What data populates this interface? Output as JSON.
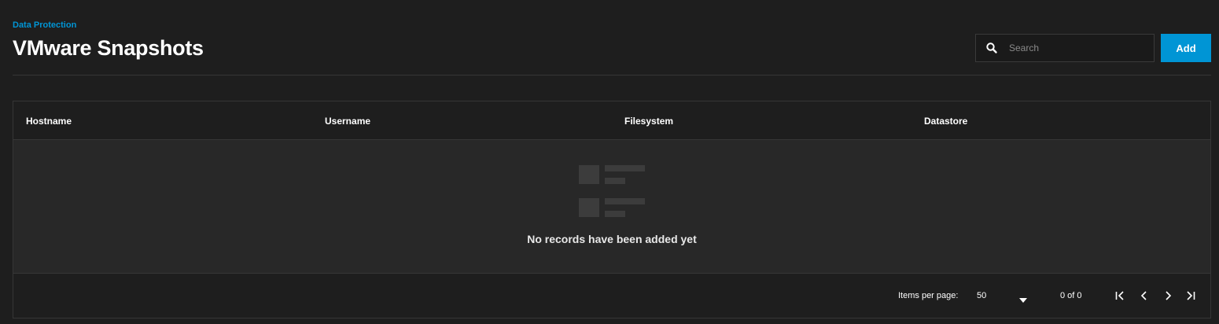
{
  "header": {
    "breadcrumb": "Data Protection",
    "title": "VMware Snapshots"
  },
  "toolbar": {
    "search_placeholder": "Search",
    "search_value": "",
    "search_icon": "search-icon",
    "add_label": "Add"
  },
  "table": {
    "columns": [
      "Hostname",
      "Username",
      "Filesystem",
      "Datastore"
    ],
    "rows": [],
    "empty_icon": "empty-list-icon",
    "empty_message": "No records have been added yet"
  },
  "paginator": {
    "items_per_page_label": "Items per page:",
    "items_per_page_value": "50",
    "range_label": "0 of 0",
    "icons": [
      "first-page-icon",
      "previous-page-icon",
      "next-page-icon",
      "last-page-icon"
    ]
  },
  "colors": {
    "background": "#1e1e1e",
    "card": "#282828",
    "accent": "#0095d5",
    "border": "#363636"
  }
}
